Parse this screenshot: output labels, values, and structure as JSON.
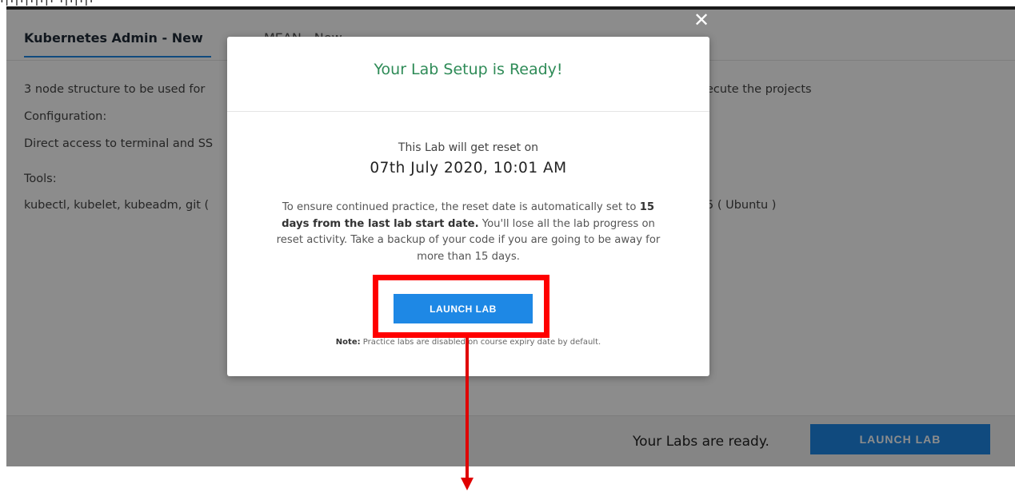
{
  "top_caption": "ı|ı|ı|ı|ı|ı ı|ı|ı|ı",
  "tabs": [
    {
      "label": "Kubernetes Admin - New"
    },
    {
      "label": "MEAN - New"
    }
  ],
  "content": {
    "line1": "3 node structure to be used for",
    "line1_right": "ecute the projects",
    "line2": "Configuration:",
    "line3": "Direct access to terminal and SS",
    "line4": "Tools:",
    "line5": "kubectl, kubelet, kubeadm, git (",
    "line5_right": "5 ( Ubuntu )"
  },
  "modal": {
    "close_glyph": "✕",
    "title": "Your Lab Setup is Ready!",
    "reset_label": "This Lab will get reset on",
    "reset_date": "07th July 2020, 10:01 AM",
    "info_part1": "To ensure continued practice, the reset date is automatically set to ",
    "info_bold": "15 days from the last lab start date.",
    "info_part2": " You'll lose all the lab progress on reset activity. Take a backup of your code if you are going to be away for more than 15 days.",
    "launch_label": "LAUNCH LAB",
    "note_bold": "Note:",
    "note_text": " Practice labs are disabled on course expiry date by default."
  },
  "bottom_bar": {
    "message": "Your Labs are ready.",
    "launch_label": "LAUNCH LAB"
  },
  "colors": {
    "accent": "#1e88e5",
    "title_green": "#2e8b57",
    "annotation_red": "#ff0000"
  }
}
